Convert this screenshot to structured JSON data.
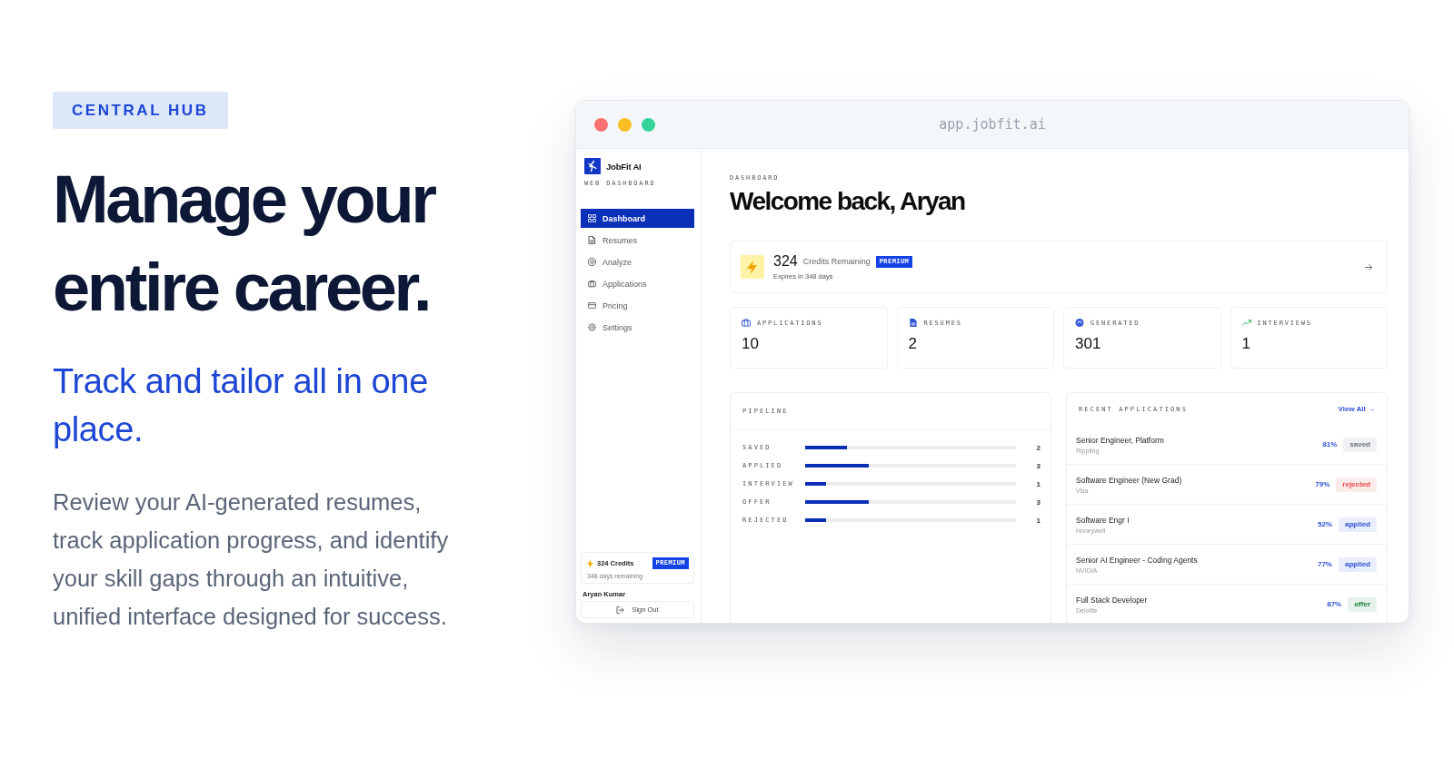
{
  "hero": {
    "tag": "CENTRAL HUB",
    "headline": "Manage your entire career.",
    "subheading": "Track and tailor all in one place.",
    "description": "Review your AI-generated resumes, track application progress, and identify your skill gaps through an intuitive, unified interface designed for success."
  },
  "browser": {
    "url": "app.jobfit.ai"
  },
  "sidebar": {
    "brand": "JobFit AI",
    "subtitle": "WEB DASHBOARD",
    "items": [
      {
        "label": "Dashboard",
        "selected": true
      },
      {
        "label": "Resumes",
        "selected": false
      },
      {
        "label": "Analyze",
        "selected": false
      },
      {
        "label": "Applications",
        "selected": false
      },
      {
        "label": "Pricing",
        "selected": false
      },
      {
        "label": "Settings",
        "selected": false
      }
    ],
    "credits": {
      "amount": "324 Credits",
      "badge": "PREMIUM",
      "note": "348 days remaining"
    },
    "user": "Aryan Kumar",
    "sign_out": "Sign Out"
  },
  "dashboard": {
    "eyebrow": "DASHBOARD",
    "title": "Welcome back, Aryan",
    "credits_card": {
      "amount": "324",
      "label": "Credits Remaining",
      "badge": "PREMIUM",
      "note": "Expires in 348 days"
    },
    "stats": [
      {
        "label": "APPLICATIONS",
        "value": "10"
      },
      {
        "label": "RESUMES",
        "value": "2"
      },
      {
        "label": "GENERATED",
        "value": "301"
      },
      {
        "label": "INTERVIEWS",
        "value": "1"
      }
    ],
    "pipeline": {
      "title": "PIPELINE",
      "stages": [
        {
          "label": "SAVED",
          "level": 0.2,
          "count": "2"
        },
        {
          "label": "APPLIED",
          "level": 0.3,
          "count": "3"
        },
        {
          "label": "INTERVIEW",
          "level": 0.1,
          "count": "1"
        },
        {
          "label": "OFFER",
          "level": 0.3,
          "count": "3"
        },
        {
          "label": "REJECTED",
          "level": 0.1,
          "count": "1"
        }
      ]
    },
    "recent_applications": {
      "title": "RECENT APPLICATIONS",
      "link": "View All →",
      "rows": [
        {
          "role": "Senior Engineer, Platform",
          "company": "Rippling",
          "match": "81%",
          "status": "saved",
          "color": "#6b7280"
        },
        {
          "role": "Software Engineer (New Grad)",
          "company": "Visa",
          "match": "79%",
          "status": "rejected",
          "color": "#ef4444"
        },
        {
          "role": "Software Engr I",
          "company": "Honeywell",
          "match": "52%",
          "status": "applied",
          "color": "#2d4fd6"
        },
        {
          "role": "Senior AI Engineer - Coding Agents",
          "company": "NVIDIA",
          "match": "77%",
          "status": "applied",
          "color": "#2d4fd6"
        },
        {
          "role": "Full Stack Developer",
          "company": "Deloitte",
          "match": "87%",
          "status": "offer",
          "color": "#15803d"
        }
      ]
    }
  }
}
